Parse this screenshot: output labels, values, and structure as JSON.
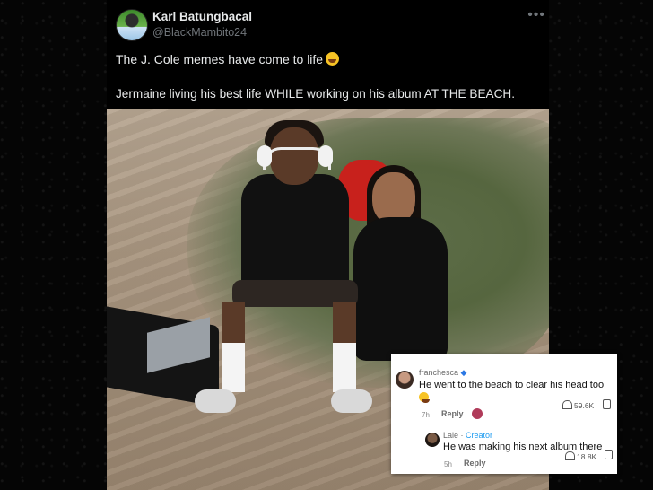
{
  "tweet": {
    "author_name": "Karl Batungbacal",
    "author_handle": "@BlackMambito24",
    "more_icon": "more-icon",
    "line1": "The J. Cole memes have come to life",
    "line1_emoji": "laughing-tears-emoji",
    "line2": "Jermaine living his best life WHILE working on his album AT THE BEACH."
  },
  "comments": [
    {
      "user": "franchesca",
      "user_badge": "butterfly-icon",
      "text": "He went to the beach to clear his head too",
      "emoji": "laughing-tears-emoji",
      "time": "7h",
      "reply_label": "Reply",
      "likes": "59.6K"
    },
    {
      "user": "Lale",
      "creator_label": "Creator",
      "text": "He was making his next album there",
      "time": "5h",
      "reply_label": "Reply",
      "likes": "18.8K"
    }
  ],
  "colors": {
    "tweet_bg": "#000000",
    "primary_text": "#e7e9ea",
    "secondary_text": "#71767b",
    "creator_blue": "#1d9bf0"
  }
}
